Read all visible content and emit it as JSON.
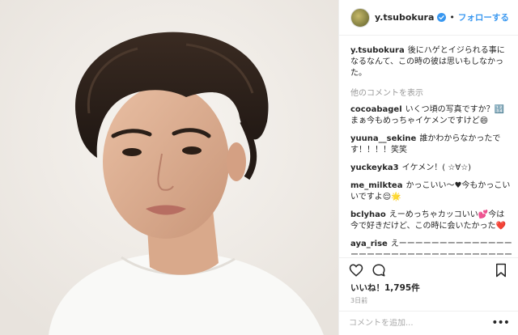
{
  "post": {
    "author": "y.tsubokura",
    "follow_label": "フォローする",
    "dot": "•"
  },
  "caption": {
    "user": "y.tsubokura",
    "text": "後にハゲとイジられる事になるなんて、この時の彼は思いもしなかった。"
  },
  "comments": {
    "view_more": "他のコメントを表示",
    "items": [
      {
        "user": "cocoabagel",
        "text": "いくつ頃の写真ですか？🔢 まぁ今もめっちゃイケメンですけど😄"
      },
      {
        "user": "yuuna__sekine",
        "text": "誰かわからなかったです！！！！笑笑"
      },
      {
        "user": "yuckeyka3",
        "text": "イケメン！( ☆∀☆)"
      },
      {
        "user": "me_milktea",
        "text": "かっこいい〜♥今もかっこいいですよ😌🌟"
      },
      {
        "user": "bclyhao",
        "text": "えーめっちゃカッコいい💕今は今で好きだけど、この時に会いたかった❤️"
      },
      {
        "user": "aya_rise",
        "text": "えーーーーーーーーーーーーーーーーーーーーーーーーーーーーーーーーーーも一疲れました！"
      }
    ]
  },
  "engagement": {
    "likes": "いいね！1,795件",
    "date": "3日前"
  },
  "add_comment": {
    "placeholder": "コメントを追加..."
  },
  "icons": {
    "like": "heart-icon",
    "comment": "comment-icon",
    "save": "bookmark-icon",
    "more": "more-options-icon",
    "verified": "verified-badge-icon"
  },
  "colors": {
    "link_blue": "#3897f0",
    "muted": "#999999",
    "border": "#efefef"
  }
}
